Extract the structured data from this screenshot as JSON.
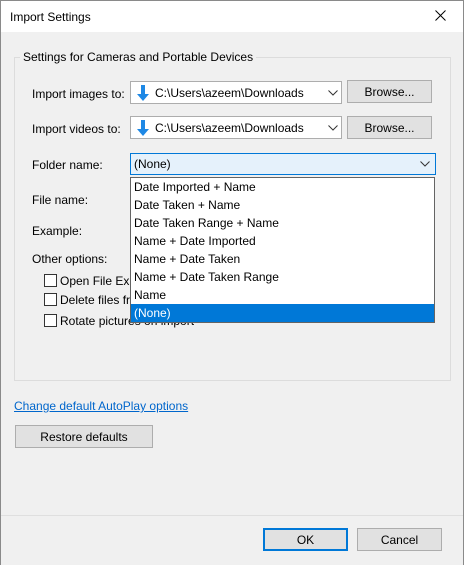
{
  "window": {
    "title": "Import Settings"
  },
  "group": {
    "legend": "Settings for Cameras and Portable Devices",
    "images_label": "Import images to:",
    "images_path": "C:\\Users\\azeem\\Downloads",
    "videos_label": "Import videos to:",
    "videos_path": "C:\\Users\\azeem\\Downloads",
    "browse_label": "Browse...",
    "folder_label": "Folder name:",
    "folder_value": "(None)",
    "file_label": "File name:",
    "example_label": "Example:",
    "other_label": "Other options:",
    "options": [
      {
        "label": "Open File Exp"
      },
      {
        "label": "Delete files fr"
      },
      {
        "label": "Rotate pictures on import"
      }
    ]
  },
  "dropdown": {
    "items": [
      "Date Imported + Name",
      "Date Taken + Name",
      "Date Taken Range + Name",
      "Name + Date Imported",
      "Name + Date Taken",
      "Name + Date Taken Range",
      "Name",
      "(None)"
    ]
  },
  "links": {
    "autoplay": "Change default AutoPlay options"
  },
  "buttons": {
    "restore": "Restore defaults",
    "ok": "OK",
    "cancel": "Cancel"
  },
  "colors": {
    "accent": "#0078d7",
    "link": "#0066cc",
    "folder_arrow": "#1e88e5"
  }
}
